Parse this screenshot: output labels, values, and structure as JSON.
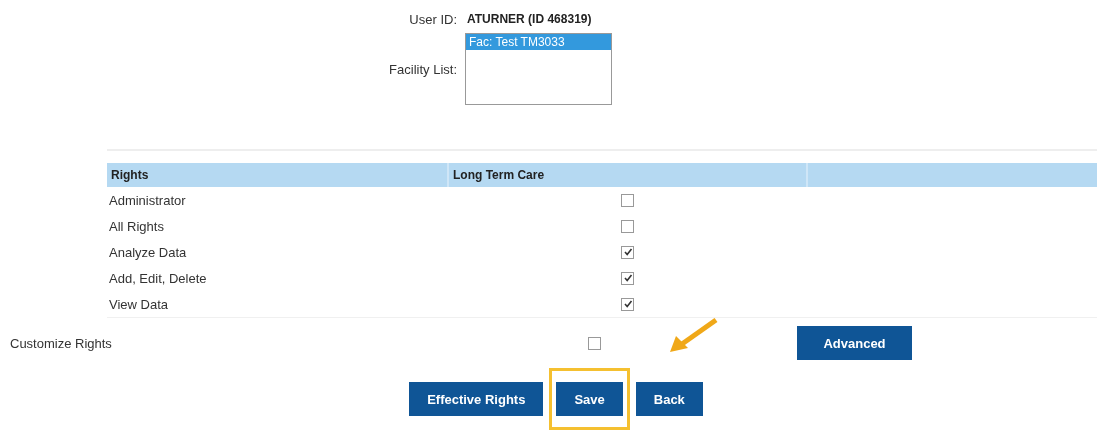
{
  "user_id": {
    "label": "User ID:",
    "value": "ATURNER (ID 468319)"
  },
  "facility_list": {
    "label": "Facility List:",
    "options": [
      {
        "label": "Fac: Test TM3033",
        "selected": true
      }
    ]
  },
  "rights_table": {
    "columns": [
      "Rights",
      "Long Term Care"
    ],
    "rows": [
      {
        "name": "Administrator",
        "checked": false
      },
      {
        "name": "All Rights",
        "checked": false
      },
      {
        "name": "Analyze Data",
        "checked": true
      },
      {
        "name": "Add, Edit, Delete",
        "checked": true
      },
      {
        "name": "View Data",
        "checked": true
      }
    ]
  },
  "customize_rights": {
    "label": "Customize Rights",
    "checked": false
  },
  "advanced_button": "Advanced",
  "buttons": [
    {
      "label": "Effective Rights",
      "highlighted": false
    },
    {
      "label": "Save",
      "highlighted": true
    },
    {
      "label": "Back",
      "highlighted": false
    }
  ]
}
